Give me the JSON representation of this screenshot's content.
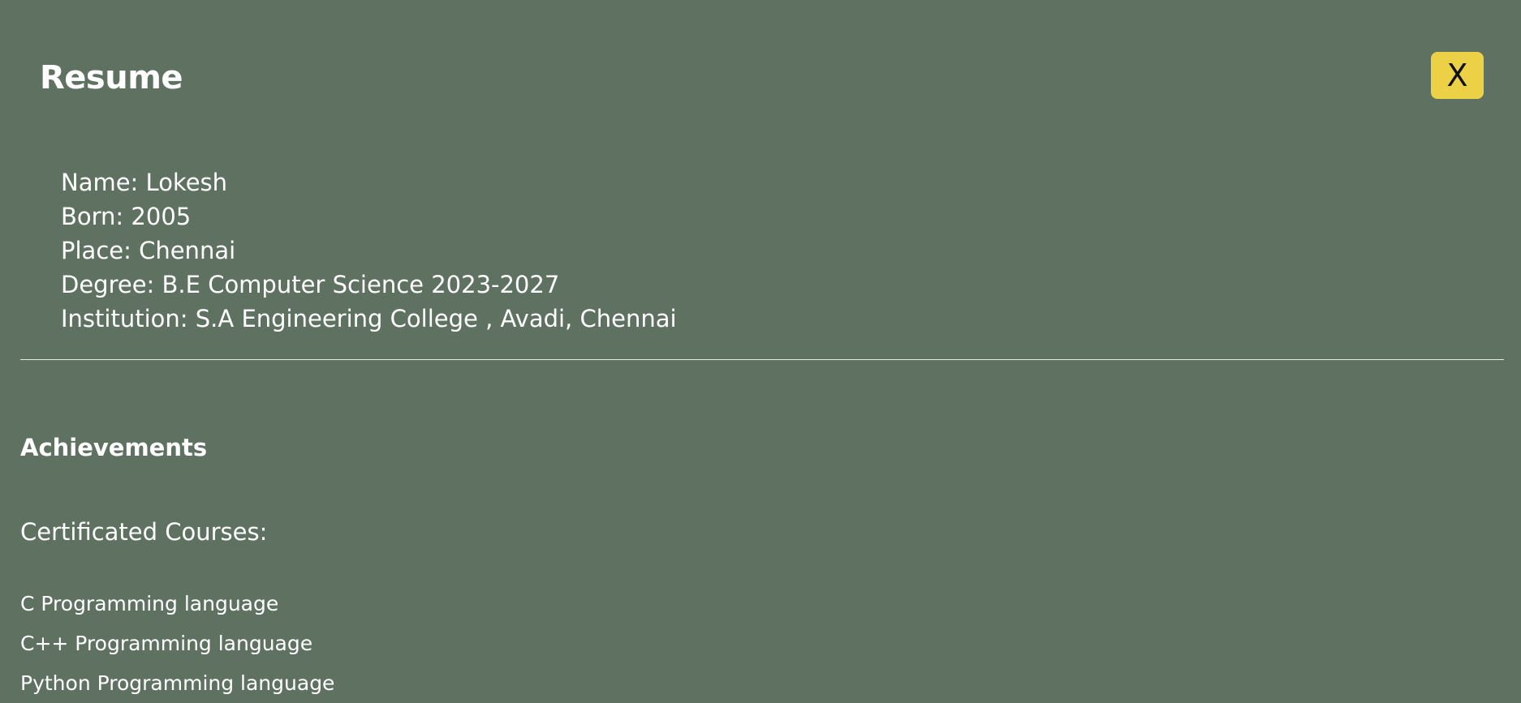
{
  "header": {
    "title": "Resume",
    "close_label": "X"
  },
  "profile": {
    "items": [
      {
        "text": "Name: Lokesh"
      },
      {
        "text": "Born: 2005"
      },
      {
        "text": "Place: Chennai"
      },
      {
        "text": "Degree: B.E Computer Science 2023-2027"
      },
      {
        "text": "Institution: S.A Engineering College , Avadi, Chennai"
      }
    ]
  },
  "achievements": {
    "heading": "Achievements",
    "courses_heading": "Certificated Courses:",
    "courses": [
      "C Programming language",
      "C++ Programming language",
      "Python Programming language"
    ]
  },
  "colors": {
    "background": "#5f7261",
    "close_button": "#ecd046",
    "text": "#ffffff"
  }
}
